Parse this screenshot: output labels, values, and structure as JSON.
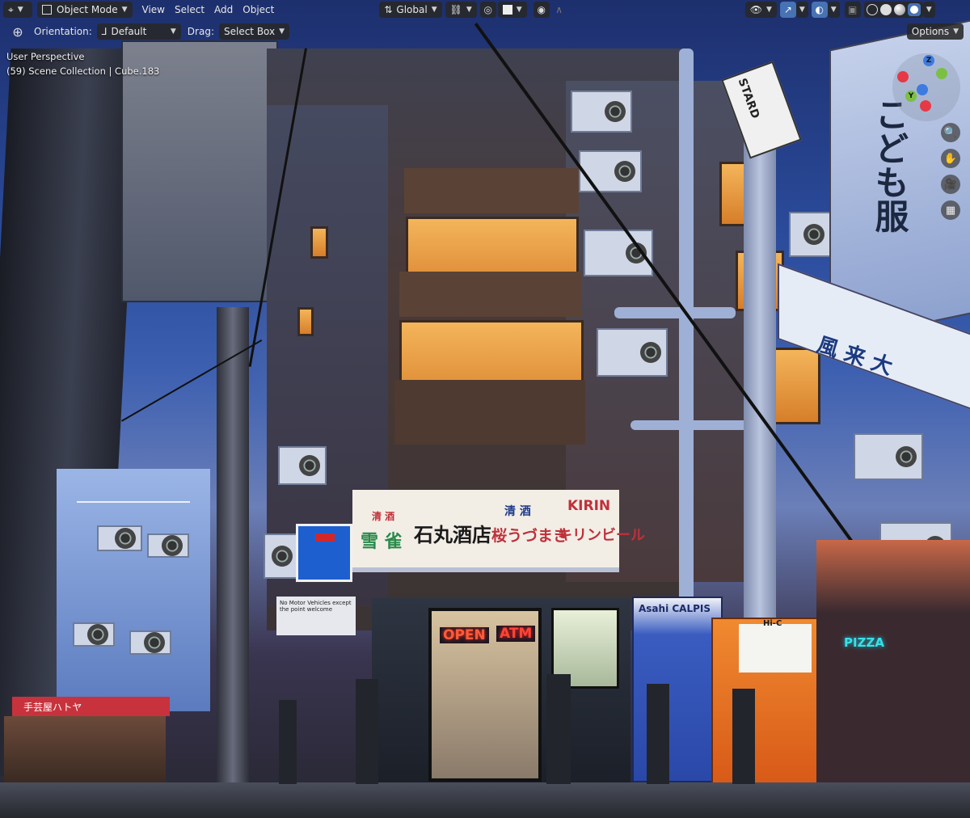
{
  "header": {
    "editor_type_icon": "3d-viewport-icon",
    "mode": "Object Mode",
    "menus": [
      "View",
      "Select",
      "Add",
      "Object"
    ],
    "transform_orientation": "Global",
    "orientation_label": "Orientation:",
    "orientation_value": "Default",
    "drag_label": "Drag:",
    "drag_value": "Select Box",
    "options_label": "Options"
  },
  "overlay": {
    "perspective": "User Perspective",
    "collection": "(59) Scene Collection | Cube.183"
  },
  "gizmo": {
    "x": "X",
    "y": "Y",
    "z": "Z"
  },
  "scene_text": {
    "kirin": "KIRIN",
    "kirin_sub": "キリンビール",
    "shop_name": "石丸酒店",
    "sake_small": "清 酒",
    "sake2": "清 酒",
    "sake_brand": "桜うづまき",
    "left_brand": "雪 雀",
    "open": "OPEN",
    "atm": "ATM",
    "pizza": "PIZZA",
    "asahi": "Asahi  CALPIS",
    "hic": "Hi-C",
    "stardo": "STARD",
    "kids_sign": "こども服",
    "wind_sign": "風 来 大",
    "no_vehicles": "No Motor Vehicles except the point welcome",
    "shop_left": "手芸屋ハトヤ"
  },
  "colors": {
    "ui_bg": "#282828",
    "ui_active": "#4772b3",
    "axis_x": "#e63946",
    "axis_y": "#7bc043",
    "axis_z": "#3d7be0"
  }
}
